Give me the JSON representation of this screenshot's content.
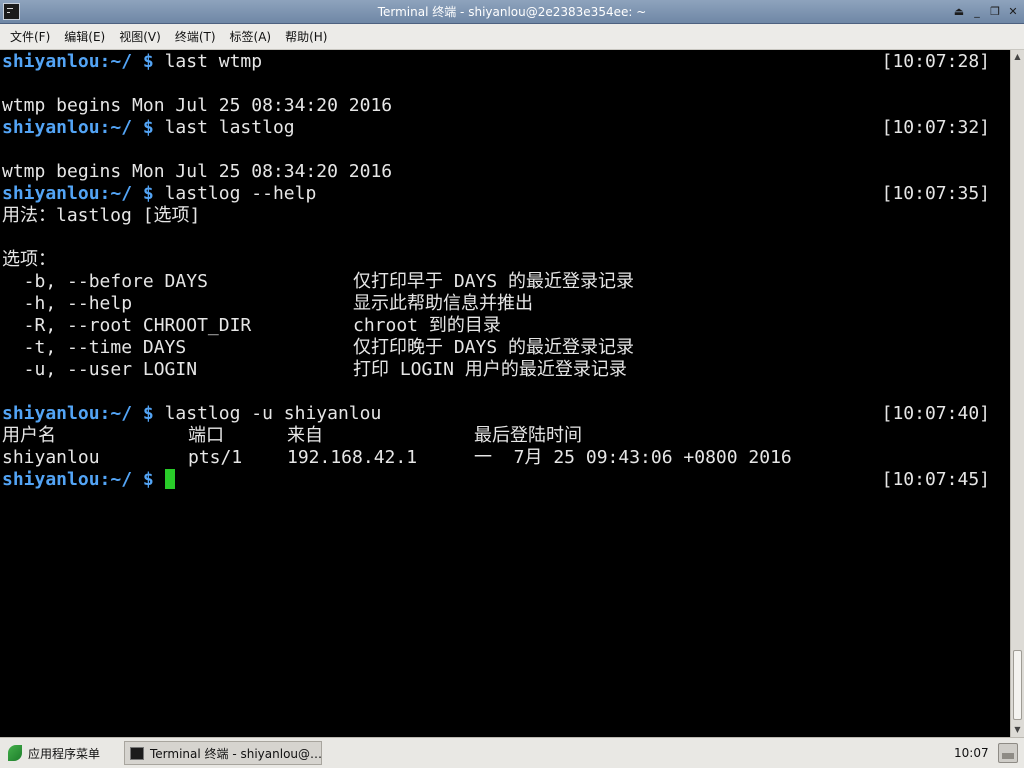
{
  "window": {
    "title": "Terminal 终端 - shiyanlou@2e2383e354ee: ~"
  },
  "window_controls": [
    "⏏",
    "_",
    "❐",
    "✕"
  ],
  "menu": [
    "文件(F)",
    "编辑(E)",
    "视图(V)",
    "终端(T)",
    "标签(A)",
    "帮助(H)"
  ],
  "colors": {
    "prompt": "#53a4f5",
    "cursor": "#29cc29",
    "background": "#000000",
    "text": "#e6e6e6"
  },
  "terminal": {
    "prompt_user": "shiyanlou",
    "prompt_path": ":~/ $ ",
    "cmd1": "last wtmp",
    "ts1": "[10:07:28]",
    "out1": "wtmp begins Mon Jul 25 08:34:20 2016",
    "cmd2": "last lastlog",
    "ts2": "[10:07:32]",
    "out2": "wtmp begins Mon Jul 25 08:34:20 2016",
    "cmd3": "lastlog --help",
    "ts3": "[10:07:35]",
    "usage": "用法：lastlog [选项]",
    "options_header": "选项：",
    "options": [
      {
        "flag": "  -b, --before DAYS",
        "desc": "仅打印早于 DAYS 的最近登录记录"
      },
      {
        "flag": "  -h, --help",
        "desc": "显示此帮助信息并推出"
      },
      {
        "flag": "  -R, --root CHROOT_DIR",
        "desc": "chroot 到的目录"
      },
      {
        "flag": "  -t, --time DAYS",
        "desc": "仅打印晚于 DAYS 的最近登录记录"
      },
      {
        "flag": "  -u, --user LOGIN",
        "desc": "打印 LOGIN 用户的最近登录记录"
      }
    ],
    "cmd4": "lastlog -u shiyanlou",
    "ts4": "[10:07:40]",
    "table_headers": [
      "用户名",
      "端口",
      "来自",
      "最后登陆时间"
    ],
    "table_row": [
      "shiyanlou",
      "pts/1",
      "192.168.42.1",
      "一  7月 25 09:43:06 +0800 2016"
    ],
    "ts5": "[10:07:45]"
  },
  "taskbar": {
    "start_label": "应用程序菜单",
    "task_label": "Terminal 终端 - shiyanlou@…",
    "clock": "10:07"
  }
}
